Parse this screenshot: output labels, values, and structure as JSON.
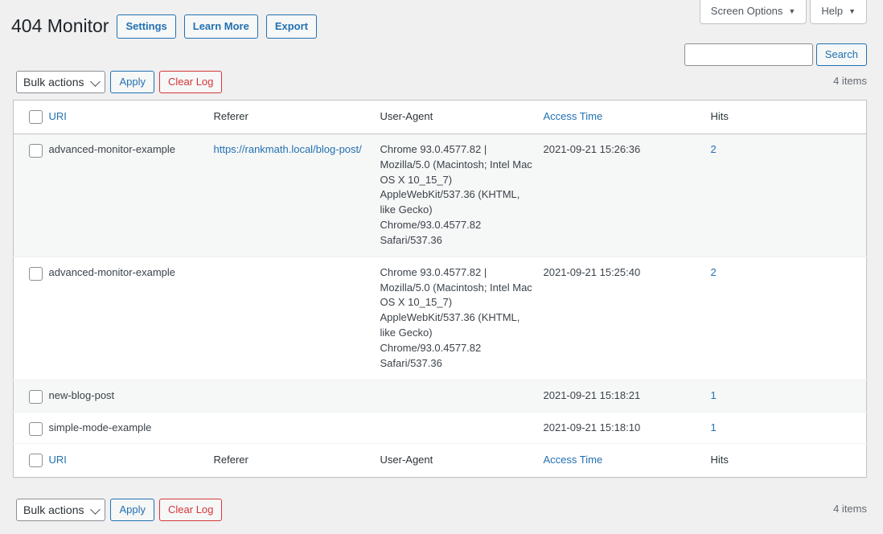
{
  "screen_meta": {
    "screen_options_label": "Screen Options",
    "help_label": "Help",
    "caret_glyph": "▼"
  },
  "header": {
    "title": "404 Monitor",
    "actions": [
      {
        "label": "Settings"
      },
      {
        "label": "Learn More"
      },
      {
        "label": "Export"
      }
    ]
  },
  "search": {
    "value": "",
    "placeholder": "",
    "button_label": "Search"
  },
  "tablenav": {
    "bulk_actions_label": "Bulk actions",
    "apply_label": "Apply",
    "clear_log_label": "Clear Log",
    "displaying_num": "4 items"
  },
  "table": {
    "columns": [
      {
        "key": "uri",
        "label": "URI",
        "sortable": true
      },
      {
        "key": "referer",
        "label": "Referer",
        "sortable": false
      },
      {
        "key": "ua",
        "label": "User-Agent",
        "sortable": false
      },
      {
        "key": "time",
        "label": "Access Time",
        "sortable": true
      },
      {
        "key": "hits",
        "label": "Hits",
        "sortable": false
      }
    ],
    "rows": [
      {
        "uri": "advanced-monitor-example",
        "referer": "https://rankmath.local/blog-post/",
        "user_agent": "Chrome 93.0.4577.82 | Mozilla/5.0 (Macintosh; Intel Mac OS X 10_15_7) AppleWebKit/537.36 (KHTML, like Gecko) Chrome/93.0.4577.82 Safari/537.36",
        "access_time": "2021-09-21 15:26:36",
        "hits": "2"
      },
      {
        "uri": "advanced-monitor-example",
        "referer": "",
        "user_agent": "Chrome 93.0.4577.82 | Mozilla/5.0 (Macintosh; Intel Mac OS X 10_15_7) AppleWebKit/537.36 (KHTML, like Gecko) Chrome/93.0.4577.82 Safari/537.36",
        "access_time": "2021-09-21 15:25:40",
        "hits": "2"
      },
      {
        "uri": "new-blog-post",
        "referer": "",
        "user_agent": "",
        "access_time": "2021-09-21 15:18:21",
        "hits": "1"
      },
      {
        "uri": "simple-mode-example",
        "referer": "",
        "user_agent": "",
        "access_time": "2021-09-21 15:18:10",
        "hits": "1"
      }
    ]
  },
  "colors": {
    "page_bg": "#f0f0f1",
    "link": "#2271b1",
    "danger": "#d63638",
    "text": "#3c434a",
    "row_alt_bg": "#f6f7f7",
    "border": "#c3c4c7"
  }
}
